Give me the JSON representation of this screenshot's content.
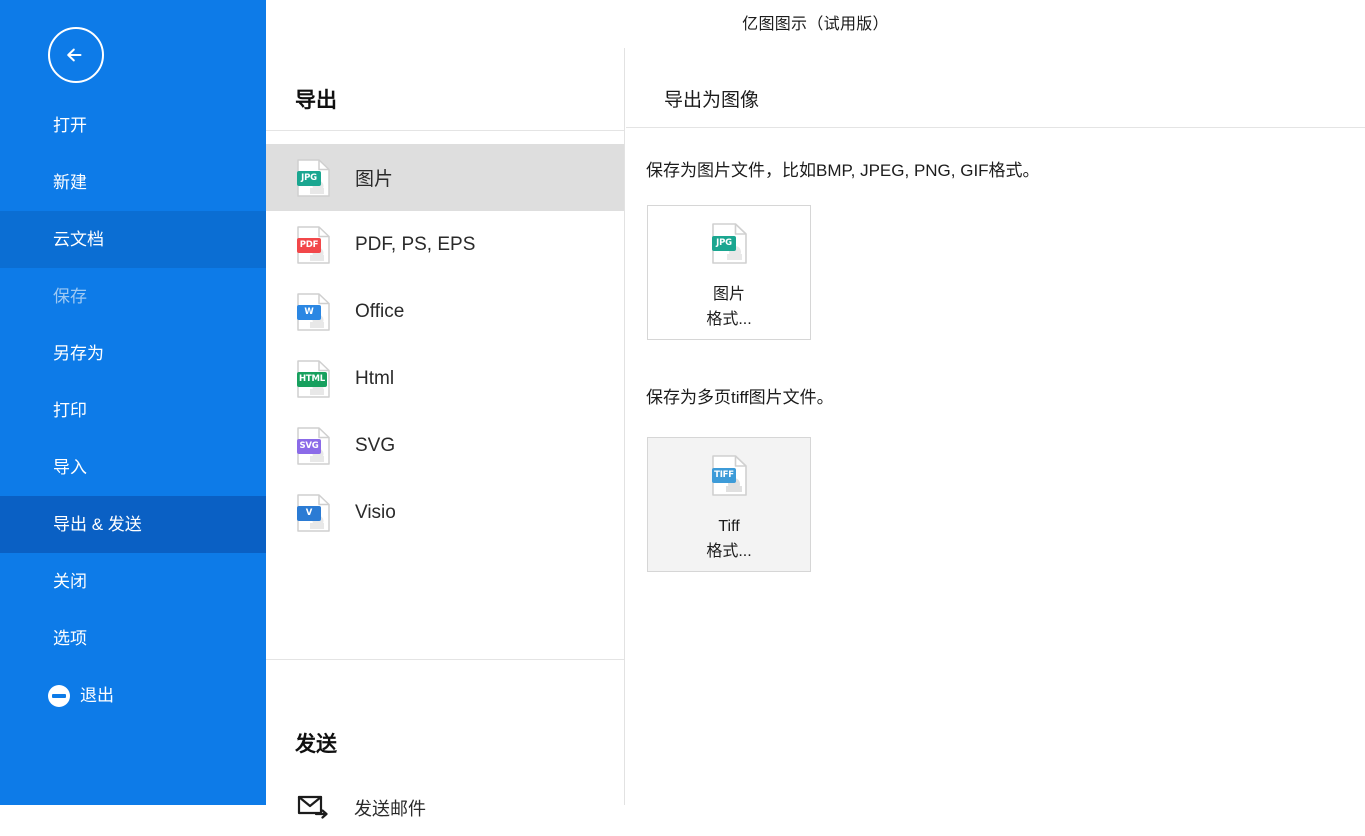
{
  "window": {
    "title": "亿图图示（试用版）"
  },
  "sidebar": {
    "back_label": "back-arrow",
    "items": [
      {
        "label": "打开",
        "state": "normal"
      },
      {
        "label": "新建",
        "state": "normal"
      },
      {
        "label": "云文档",
        "state": "hover"
      },
      {
        "label": "保存",
        "state": "disabled"
      },
      {
        "label": "另存为",
        "state": "normal"
      },
      {
        "label": "打印",
        "state": "normal"
      },
      {
        "label": "导入",
        "state": "normal"
      },
      {
        "label": "导出 & 发送",
        "state": "active"
      },
      {
        "label": "关闭",
        "state": "normal"
      },
      {
        "label": "选项",
        "state": "normal"
      },
      {
        "label": "退出",
        "state": "normal",
        "icon": "exit-circle-minus-icon"
      }
    ],
    "colors": {
      "base": "#0d7be8",
      "hover": "#0b6ed3",
      "active": "#0a60c4",
      "disabled_text": "#9ec9f3"
    }
  },
  "middle": {
    "export_heading": "导出",
    "export_items": [
      {
        "label": "图片",
        "badge": "JPG",
        "badge_color": "#1aa690",
        "selected": true
      },
      {
        "label": "PDF, PS, EPS",
        "badge": "PDF",
        "badge_color": "#f2474a",
        "selected": false
      },
      {
        "label": "Office",
        "badge": "W",
        "badge_color": "#2b87e3",
        "selected": false
      },
      {
        "label": "Html",
        "badge": "HTML",
        "badge_color": "#17a05e",
        "selected": false
      },
      {
        "label": "SVG",
        "badge": "SVG",
        "badge_color": "#8b6be8",
        "selected": false
      },
      {
        "label": "Visio",
        "badge": "V",
        "badge_color": "#2b7bd4",
        "selected": false
      }
    ],
    "send_heading": "发送",
    "send_items": [
      {
        "label": "发送邮件",
        "icon": "mail-send-icon"
      }
    ]
  },
  "right": {
    "heading": "导出为图像",
    "sections": [
      {
        "description": "保存为图片文件，比如BMP, JPEG, PNG, GIF格式。",
        "card": {
          "line1": "图片",
          "line2": "格式...",
          "badge": "JPG",
          "badge_color": "#1aa690",
          "hovered": false
        }
      },
      {
        "description": "保存为多页tiff图片文件。",
        "card": {
          "line1": "Tiff",
          "line2": "格式...",
          "badge": "TIFF",
          "badge_color": "#3d9bd8",
          "hovered": true
        }
      }
    ]
  }
}
